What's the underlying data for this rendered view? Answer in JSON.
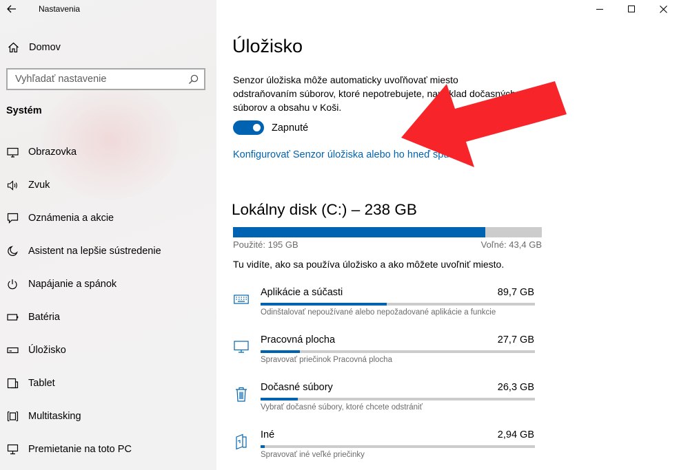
{
  "window": {
    "title": "Nastavenia",
    "controls": {
      "minimize": "minimize-icon",
      "maximize": "maximize-icon",
      "close": "close-icon"
    }
  },
  "sidebar": {
    "home": "Domov",
    "search_placeholder": "Vyhľadať nastavenie",
    "section": "Systém",
    "items": [
      {
        "label": "Obrazovka",
        "icon": "monitor-icon"
      },
      {
        "label": "Zvuk",
        "icon": "speaker-icon"
      },
      {
        "label": "Oznámenia a akcie",
        "icon": "notification-icon"
      },
      {
        "label": "Asistent na lepšie sústredenie",
        "icon": "moon-icon"
      },
      {
        "label": "Napájanie a spánok",
        "icon": "power-icon"
      },
      {
        "label": "Batéria",
        "icon": "battery-icon"
      },
      {
        "label": "Úložisko",
        "icon": "storage-icon"
      },
      {
        "label": "Tablet",
        "icon": "tablet-icon"
      },
      {
        "label": "Multitasking",
        "icon": "multitasking-icon"
      },
      {
        "label": "Premietanie na toto PC",
        "icon": "projecting-icon"
      }
    ]
  },
  "main": {
    "title": "Úložisko",
    "description": "Senzor úložiska môže automaticky uvoľňovať miesto odstraňovaním súborov, ktoré nepotrebujete, napríklad dočasných súborov a obsahu v Koši.",
    "toggle_label": "Zapnuté",
    "toggle_on": true,
    "configure_link": "Konfigurovať Senzor úložiska alebo ho hneď spustiť",
    "disk": {
      "title": "Lokálny disk (C:) – 238 GB",
      "used": "Použité: 195 GB",
      "free": "Voľné: 43,4 GB",
      "used_fraction": 0.818
    },
    "intro": "Tu vidíte, ako sa používa úložisko a ako môžete uvoľniť miesto.",
    "categories": [
      {
        "name": "Aplikácie a súčasti",
        "size": "89,7 GB",
        "subtitle": "Odinštalovať nepoužívané alebo nepožadované aplikácie a funkcie",
        "fraction": 0.46,
        "icon": "keyboard-icon"
      },
      {
        "name": "Pracovná plocha",
        "size": "27,7 GB",
        "subtitle": "Spravovať priečinok Pracovná plocha",
        "fraction": 0.142,
        "icon": "desktop-icon"
      },
      {
        "name": "Dočasné súbory",
        "size": "26,3 GB",
        "subtitle": "Vybrať dočasné súbory, ktoré chcete odstrániť",
        "fraction": 0.135,
        "icon": "trash-icon"
      },
      {
        "name": "Iné",
        "size": "2,94 GB",
        "subtitle": "Spravovať iné veľké priečinky",
        "fraction": 0.015,
        "icon": "folder-icon"
      }
    ]
  },
  "colors": {
    "accent": "#0063b1",
    "arrow": "#f7242a",
    "sidebar_bg": "#f2f2f2"
  }
}
